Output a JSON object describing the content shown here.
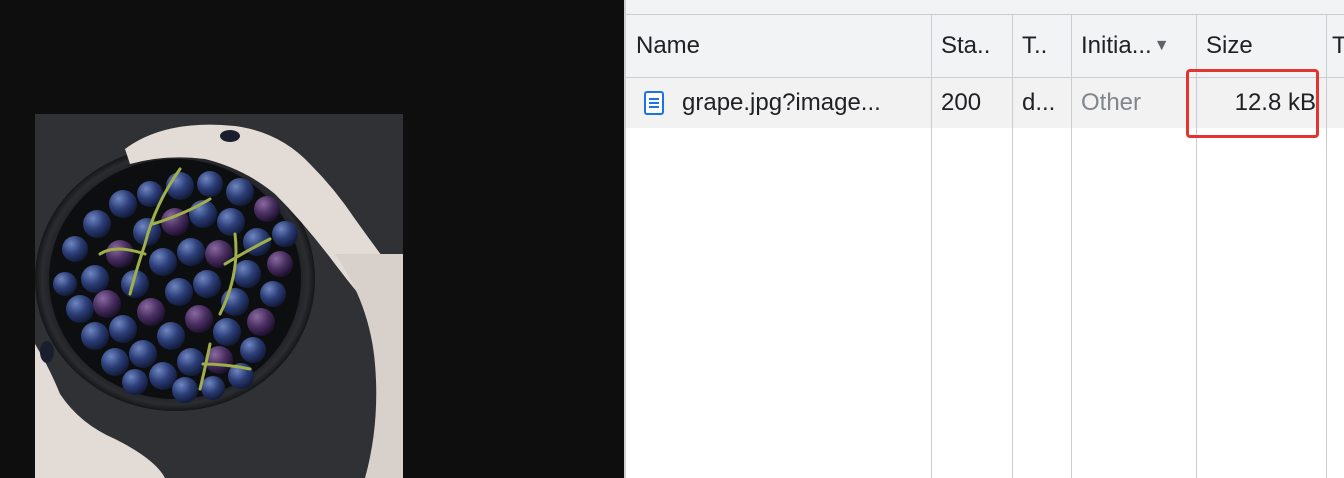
{
  "page_preview": {
    "image_alt": "Bowl of dark blue grapes held by two hands"
  },
  "network_panel": {
    "columns": [
      {
        "label": "Name"
      },
      {
        "label": "Sta.."
      },
      {
        "label": "T.."
      },
      {
        "label": "Initia..."
      },
      {
        "label": "Size"
      },
      {
        "label": "T"
      }
    ],
    "sort_indicator_icon": "triangle-down-icon",
    "rows": [
      {
        "icon": "document-icon",
        "name": "grape.jpg?image...",
        "status": "200",
        "type": "d...",
        "initiator": "Other",
        "size": "12.8 kB"
      }
    ]
  },
  "colors": {
    "highlight": "#e3342f",
    "header_bg": "#f1f3f4",
    "row_bg": "#f2f2f2",
    "icon_blue": "#1a73e8"
  }
}
